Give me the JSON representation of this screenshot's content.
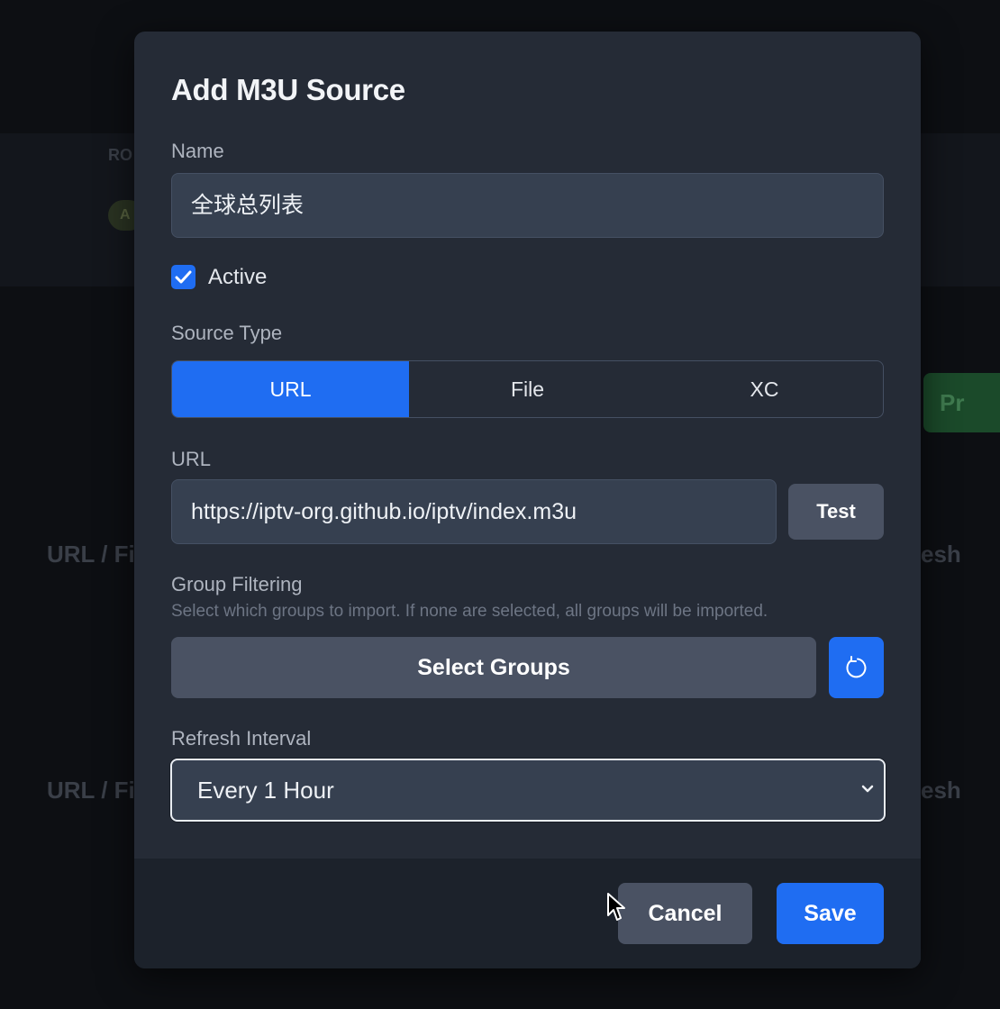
{
  "background": {
    "row_label_1": "URL / Fi",
    "row_label_2": "URL / Fi",
    "right_label_1": "esh",
    "right_label_2": "esh",
    "small_header": "RO",
    "badge": "A",
    "green_button": "Pr"
  },
  "modal": {
    "title": "Add M3U Source",
    "name_label": "Name",
    "name_value": "全球总列表",
    "active_label": "Active",
    "active_checked": true,
    "source_type_label": "Source Type",
    "source_types": [
      "URL",
      "File",
      "XC"
    ],
    "source_type_selected": "URL",
    "url_label": "URL",
    "url_value": "https://iptv-org.github.io/iptv/index.m3u",
    "test_button": "Test",
    "group_filtering_label": "Group Filtering",
    "group_filtering_help": "Select which groups to import. If none are selected, all groups will be imported.",
    "select_groups_button": "Select Groups",
    "refresh_interval_label": "Refresh Interval",
    "refresh_interval_value": "Every 1 Hour",
    "cancel_button": "Cancel",
    "save_button": "Save"
  },
  "colors": {
    "accent": "#1f6df2",
    "modal_bg": "#252b36",
    "input_bg": "#364050",
    "secondary_button": "#4a5263"
  }
}
